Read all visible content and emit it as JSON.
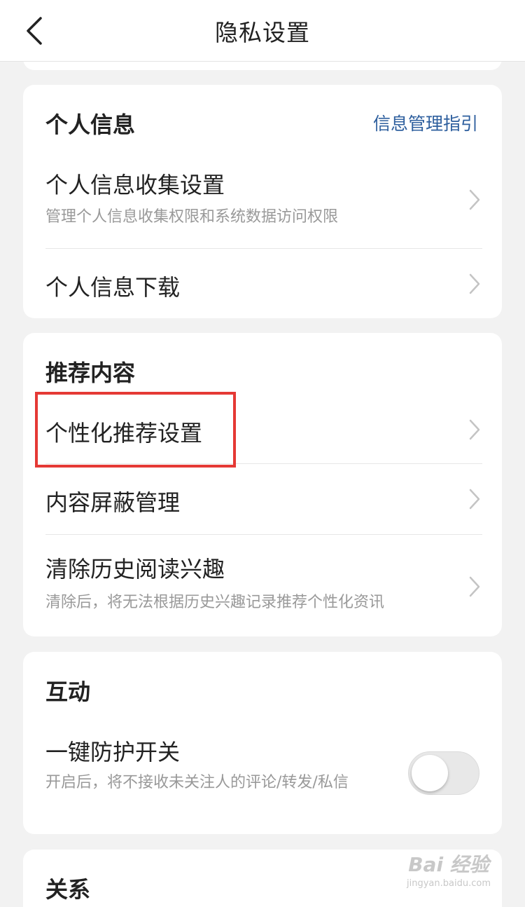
{
  "header": {
    "title": "隐私设置"
  },
  "personal_info": {
    "section_title": "个人信息",
    "guide_link": "信息管理指引",
    "items": [
      {
        "title": "个人信息收集设置",
        "desc": "管理个人信息收集权限和系统数据访问权限"
      },
      {
        "title": "个人信息下载"
      }
    ]
  },
  "recommend": {
    "section_title": "推荐内容",
    "items": [
      {
        "title": "个性化推荐设置"
      },
      {
        "title": "内容屏蔽管理"
      },
      {
        "title": "清除历史阅读兴趣",
        "desc": "清除后，将无法根据历史兴趣记录推荐个性化资讯"
      }
    ]
  },
  "interaction": {
    "section_title": "互动",
    "protect": {
      "title": "一键防护开关",
      "desc": "开启后，将不接收未关注人的评论/转发/私信",
      "enabled": false
    }
  },
  "relation": {
    "section_title": "关系"
  },
  "watermark": {
    "main": "Bai 经验",
    "sub": "jingyan.baidu.com"
  },
  "colors": {
    "link": "#2e5f9e",
    "highlight": "#e53935",
    "background": "#f2f2f2"
  }
}
